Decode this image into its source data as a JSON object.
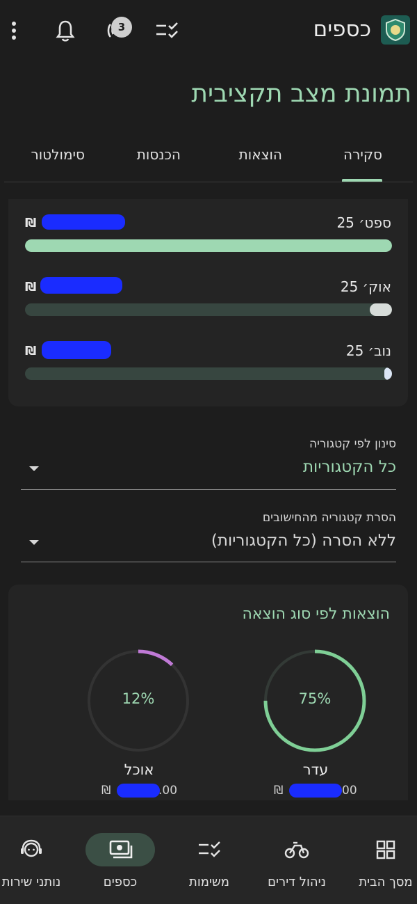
{
  "app": {
    "title": "כספים",
    "notification_count": "3"
  },
  "page_title": "תמונת מצב תקציבית",
  "tabs": [
    {
      "label": "סקירה",
      "active": true
    },
    {
      "label": "הוצאות",
      "active": false
    },
    {
      "label": "הכנסות",
      "active": false
    },
    {
      "label": "סימולטור",
      "active": false
    }
  ],
  "months": [
    {
      "label": "ספט׳ 25",
      "currency": "₪",
      "progress": 1.0,
      "fill_color": "#9ed8b2",
      "end_color": "#9ed8b2"
    },
    {
      "label": "אוק׳ 25",
      "currency": "₪",
      "progress": 0.06,
      "fill_color": "#374640",
      "end_color": "#d7dcd9"
    },
    {
      "label": "נוב׳ 25",
      "currency": "₪",
      "progress": 0.02,
      "fill_color": "#374640",
      "end_color": "#dbe6f5"
    }
  ],
  "filter_category": {
    "label": "סינון לפי קטגוריה",
    "value": "כל הקטגוריות",
    "value_color": "#9ed8b2"
  },
  "exclude_category": {
    "label": "הסרת קטגוריה מהחישובים",
    "value": "ללא הסרה (כל הקטגוריות)",
    "value_color": "#d8d8d8"
  },
  "expense_types": {
    "title": "הוצאות לפי סוג הוצאה",
    "items": [
      {
        "name": "עדר",
        "percent_label": "75%",
        "percent": 75,
        "color": "#7fcf96",
        "amount_prefix": "₪",
        "amount_suffix": "00"
      },
      {
        "name": "אוכל",
        "percent_label": "12%",
        "percent": 12,
        "color": "#c07ad6",
        "amount_prefix": "₪",
        "amount_suffix": ".00"
      }
    ]
  },
  "bottom_nav": [
    {
      "label": "מסך הבית",
      "icon": "grid-icon",
      "active": false
    },
    {
      "label": "ניהול דירים",
      "icon": "bicycle-icon",
      "active": false
    },
    {
      "label": "משימות",
      "icon": "checklist-icon",
      "active": false
    },
    {
      "label": "כספים",
      "icon": "money-icon",
      "active": true
    },
    {
      "label": "נותני שירות",
      "icon": "support-agent-icon",
      "active": false
    }
  ],
  "colors": {
    "accent": "#9ed8b2",
    "background": "#1d1d1d",
    "card": "#242424",
    "redaction": "#1a2cff"
  }
}
